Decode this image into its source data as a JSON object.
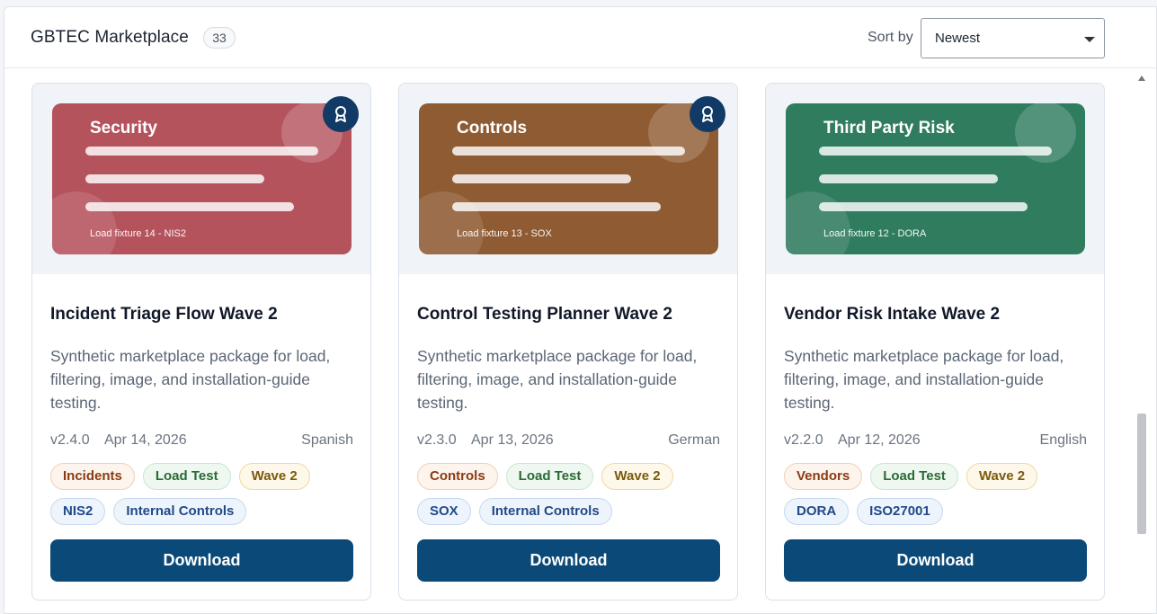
{
  "header": {
    "title": "GBTEC Marketplace",
    "count": "33",
    "sort_label": "Sort by",
    "sort_value": "Newest"
  },
  "cards": [
    {
      "banner_title": "Security",
      "banner_sub": "Load fixture 14 - NIS2",
      "banner_color": "#b5535d",
      "title": "Incident Triage Flow Wave 2",
      "desc": "Synthetic marketplace package for load, filtering, image, and installation-guide testing.",
      "version": "v2.4.0",
      "date": "Apr 14, 2026",
      "language": "Spanish",
      "award": true,
      "tags": [
        {
          "label": "Incidents",
          "style": "orange"
        },
        {
          "label": "Load Test",
          "style": "green"
        },
        {
          "label": "Wave 2",
          "style": "yellow"
        },
        {
          "label": "NIS2",
          "style": "blue"
        },
        {
          "label": "Internal Controls",
          "style": "blue"
        }
      ],
      "button": "Download"
    },
    {
      "banner_title": "Controls",
      "banner_sub": "Load fixture 13 - SOX",
      "banner_color": "#8f5b33",
      "title": "Control Testing Planner Wave 2",
      "desc": "Synthetic marketplace package for load, filtering, image, and installation-guide testing.",
      "version": "v2.3.0",
      "date": "Apr 13, 2026",
      "language": "German",
      "award": true,
      "tags": [
        {
          "label": "Controls",
          "style": "orange"
        },
        {
          "label": "Load Test",
          "style": "green"
        },
        {
          "label": "Wave 2",
          "style": "yellow"
        },
        {
          "label": "SOX",
          "style": "blue"
        },
        {
          "label": "Internal Controls",
          "style": "blue"
        }
      ],
      "button": "Download"
    },
    {
      "banner_title": "Third Party Risk",
      "banner_sub": "Load fixture 12 - DORA",
      "banner_color": "#2f7c5f",
      "title": "Vendor Risk Intake Wave 2",
      "desc": "Synthetic marketplace package for load, filtering, image, and installation-guide testing.",
      "version": "v2.2.0",
      "date": "Apr 12, 2026",
      "language": "English",
      "award": false,
      "tags": [
        {
          "label": "Vendors",
          "style": "orange"
        },
        {
          "label": "Load Test",
          "style": "green"
        },
        {
          "label": "Wave 2",
          "style": "yellow"
        },
        {
          "label": "DORA",
          "style": "blue"
        },
        {
          "label": "ISO27001",
          "style": "blue"
        }
      ],
      "button": "Download"
    }
  ]
}
